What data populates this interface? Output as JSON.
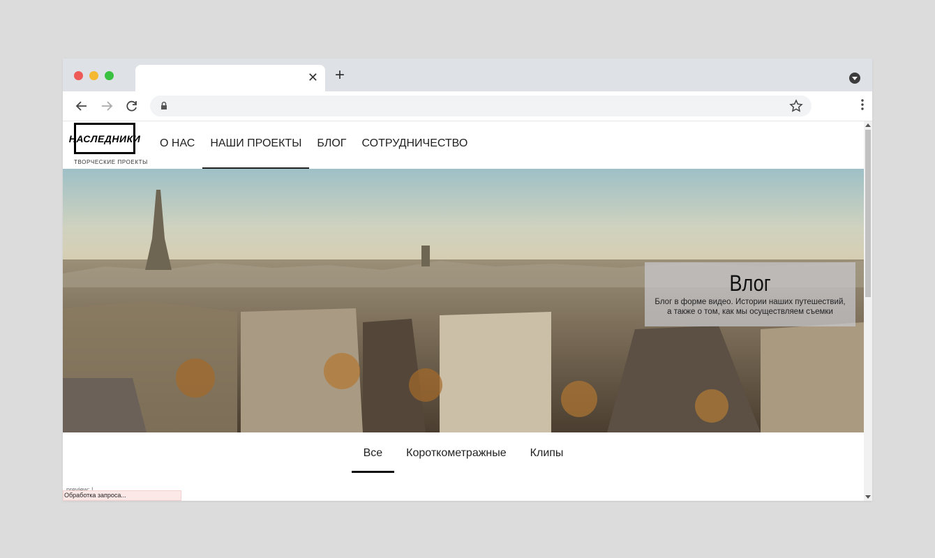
{
  "browser": {
    "tab_close_label": "✕",
    "new_tab_label": "+"
  },
  "site": {
    "logo": {
      "text": "НАСЛЕДНИКИ",
      "subtitle": "ТВОРЧЕСКИЕ ПРОЕКТЫ"
    },
    "menu": [
      {
        "label": "О НАС",
        "active": false
      },
      {
        "label": "НАШИ ПРОЕКТЫ",
        "active": true
      },
      {
        "label": "БЛОГ",
        "active": false
      },
      {
        "label": "СОТРУДНИЧЕСТВО",
        "active": false
      }
    ]
  },
  "hero": {
    "title": "Влог",
    "description": "Блог в форме видео. Истории наших путешествий, а также о том, как мы осуществляем съемки"
  },
  "filters": [
    {
      "label": "Все",
      "active": true
    },
    {
      "label": "Короткометражные",
      "active": false
    },
    {
      "label": "Клипы",
      "active": false
    }
  ],
  "status": {
    "partial_text": "preview: !",
    "processing": "Обработка запроса..."
  },
  "colors": {
    "close_dot": "#ee5b57",
    "minimize_dot": "#f5b931",
    "maximize_dot": "#3bc141",
    "tabbar_bg": "#dee1e6",
    "status_bg": "#fde8e8"
  }
}
